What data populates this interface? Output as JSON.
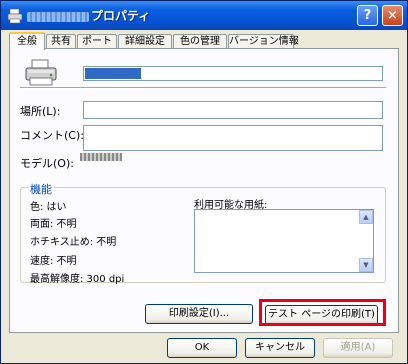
{
  "window": {
    "title_suffix": "プロパティ",
    "help_label": "?",
    "close_label": "×"
  },
  "tabs": [
    {
      "label": "全般"
    },
    {
      "label": "共有"
    },
    {
      "label": "ポート"
    },
    {
      "label": "詳細設定"
    },
    {
      "label": "色の管理"
    },
    {
      "label": "バージョン情報"
    }
  ],
  "general": {
    "location_label": "場所(L):",
    "location_value": "",
    "comment_label": "コメント(C):",
    "comment_value": "",
    "model_label": "モデル(O):"
  },
  "features": {
    "title": "機能",
    "color": "色: はい",
    "duplex": "両面: 不明",
    "staple": "ホチキス止め: 不明",
    "speed": "速度: 不明",
    "resolution": "最高解像度: 300 dpi",
    "paper_label": "利用可能な用紙:",
    "scroll_up": "▲",
    "scroll_down": "▼"
  },
  "buttons": {
    "print_prefs": "印刷設定(I)...",
    "test_page": "テスト ページの印刷(T)",
    "ok": "OK",
    "cancel": "キャンセル",
    "apply": "適用(A)"
  },
  "colors": {
    "highlight": "#e8001c",
    "titlebar": "#0553d6",
    "group_title": "#0046d5"
  }
}
